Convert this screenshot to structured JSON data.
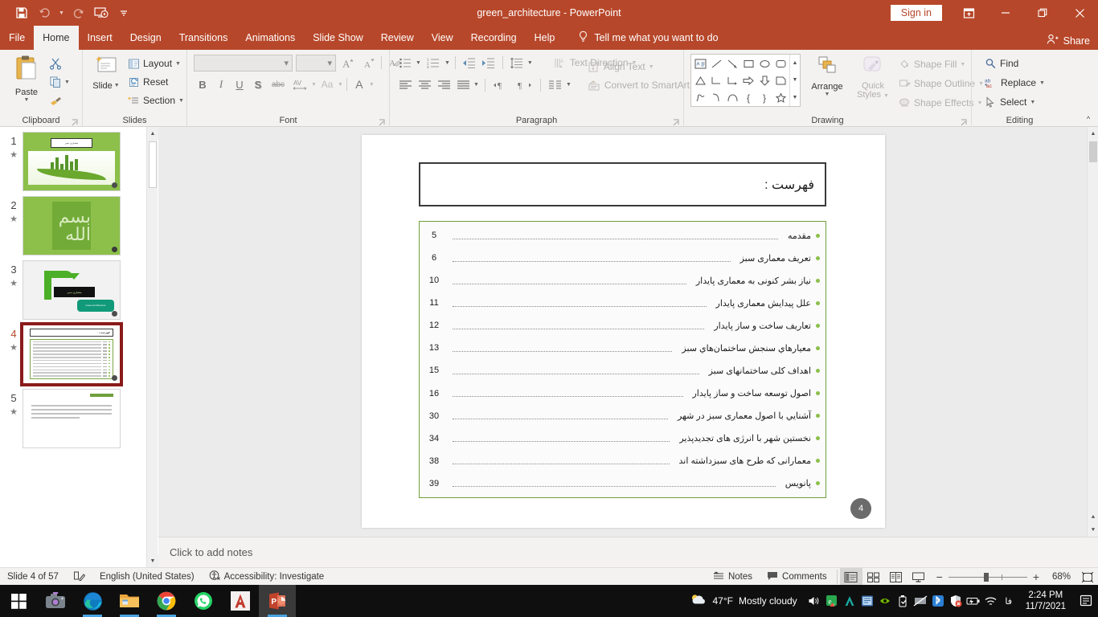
{
  "titlebar": {
    "document_title": "green_architecture  -  PowerPoint",
    "quick_access": [
      {
        "name": "save-icon",
        "label": "Save"
      },
      {
        "name": "undo-icon",
        "label": "Undo"
      },
      {
        "name": "redo-icon",
        "label": "Redo"
      },
      {
        "name": "start-presentation-icon",
        "label": "Start From Beginning"
      },
      {
        "name": "customize-qat-icon",
        "label": "Customize Quick Access Toolbar"
      }
    ],
    "sign_in": "Sign in",
    "ribbon_display_options": "Ribbon Display Options",
    "minimize": "Minimize",
    "restore": "Restore Down",
    "close": "Close"
  },
  "tabs": [
    {
      "label": "File",
      "active": false
    },
    {
      "label": "Home",
      "active": true
    },
    {
      "label": "Insert",
      "active": false
    },
    {
      "label": "Design",
      "active": false
    },
    {
      "label": "Transitions",
      "active": false
    },
    {
      "label": "Animations",
      "active": false
    },
    {
      "label": "Slide Show",
      "active": false
    },
    {
      "label": "Review",
      "active": false
    },
    {
      "label": "View",
      "active": false
    },
    {
      "label": "Recording",
      "active": false
    },
    {
      "label": "Help",
      "active": false
    }
  ],
  "tell_me": "Tell me what you want to do",
  "share": "Share",
  "ribbon": {
    "clipboard": {
      "label": "Clipboard",
      "paste": "Paste",
      "cut": "Cut",
      "copy": "Copy",
      "format_painter": "Format Painter"
    },
    "slides": {
      "label": "Slides",
      "new_slide": "New\nSlide",
      "new_slide_line1": "New",
      "new_slide_line2": "Slide",
      "layout": "Layout",
      "reset": "Reset",
      "section": "Section"
    },
    "font": {
      "label": "Font",
      "font_name": "",
      "font_size": "",
      "increase_size": "Increase Font Size",
      "decrease_size": "Decrease Font Size",
      "clear_formatting": "Clear All Formatting",
      "bold": "B",
      "italic": "I",
      "underline": "U",
      "shadow": "S",
      "strikethrough": "abc",
      "character_spacing": "AV",
      "change_case": "Aa",
      "font_color": "A"
    },
    "paragraph": {
      "label": "Paragraph",
      "bullets": "Bullets",
      "numbering": "Numbering",
      "decrease_indent": "Decrease List Level",
      "increase_indent": "Increase List Level",
      "line_spacing": "Line Spacing",
      "align_left": "Align Left",
      "align_center": "Center",
      "align_right": "Align Right",
      "justify": "Justify",
      "ltr": "Left-to-Right Text Direction",
      "rtl": "Right-to-Left Text Direction",
      "columns": "Columns",
      "text_direction": "Text Direction",
      "align_text": "Align Text",
      "convert_to_smartart": "Convert to SmartArt"
    },
    "drawing": {
      "label": "Drawing",
      "arrange": "Arrange",
      "quick_styles_line1": "Quick",
      "quick_styles_line2": "Styles",
      "shape_fill": "Shape Fill",
      "shape_outline": "Shape Outline",
      "shape_effects": "Shape Effects"
    },
    "editing": {
      "label": "Editing",
      "find": "Find",
      "replace": "Replace",
      "select": "Select"
    },
    "collapse": "Collapse the Ribbon"
  },
  "thumbnails": [
    {
      "number": "1",
      "selected": false,
      "title_text": "معماری سبز"
    },
    {
      "number": "2",
      "selected": false,
      "title_text": "بسم الله"
    },
    {
      "number": "3",
      "selected": false,
      "title_text": "معماری سبز",
      "badge_text": "Green Architecture"
    },
    {
      "number": "4",
      "selected": true,
      "title_text": "فهرست :"
    },
    {
      "number": "5",
      "selected": false,
      "title_text": "مقدمه"
    }
  ],
  "slide": {
    "title": "فهرست :",
    "badge": "4",
    "toc": [
      {
        "label": "مقدمه",
        "page": "5"
      },
      {
        "label": "تعریف معماری سبز",
        "page": "6"
      },
      {
        "label": "نیاز بشر کنونی به معماری پایدار",
        "page": "10"
      },
      {
        "label": "علل پیدایش معماری پایدار",
        "page": "11"
      },
      {
        "label": "تعاریف ساخت و ساز پایدار",
        "page": "12"
      },
      {
        "label": "معیارهاي سنجش ساختمان‌هاي سبز",
        "page": "13"
      },
      {
        "label": "اهداف کلی ساختمانهای سبز",
        "page": "15"
      },
      {
        "label": "اصول توسعه ساخت و ساز پایدار",
        "page": "16"
      },
      {
        "label": "آشنایي با اصول معماری سبز در شهر",
        "page": "30"
      },
      {
        "label": "نخستین شهر با انرژی های تجدیدپذیر",
        "page": "34"
      },
      {
        "label": "معمارانی که طرح های سبزداشته اند",
        "page": "38"
      },
      {
        "label": "پانویس",
        "page": "39"
      }
    ]
  },
  "notes": {
    "placeholder": "Click to add notes"
  },
  "statusbar": {
    "slide_indicator": "Slide 4 of 57",
    "spellcheck": "Spelling and Grammar Check",
    "language": "English (United States)",
    "accessibility": "Accessibility: Investigate",
    "notes": "Notes",
    "comments": "Comments",
    "view_normal": "Normal",
    "view_slide_sorter": "Slide Sorter",
    "view_reading": "Reading View",
    "view_slideshow": "Slide Show",
    "zoom_out": "Zoom Out",
    "zoom_in": "Zoom In",
    "zoom_level": "68%",
    "fit_to_window": "Fit slide to current window"
  },
  "taskbar": {
    "apps": [
      {
        "name": "start-button",
        "label": "Start"
      },
      {
        "name": "camera-icon",
        "label": "Camera"
      },
      {
        "name": "edge-icon",
        "label": "Microsoft Edge"
      },
      {
        "name": "file-explorer-icon",
        "label": "File Explorer"
      },
      {
        "name": "chrome-icon",
        "label": "Google Chrome"
      },
      {
        "name": "whatsapp-icon",
        "label": "WhatsApp"
      },
      {
        "name": "autocad-icon",
        "label": "AutoCAD"
      },
      {
        "name": "powerpoint-icon",
        "label": "PowerPoint"
      }
    ],
    "weather_temp": "47°F",
    "weather_desc": "Mostly cloudy",
    "time": "2:24 PM",
    "date": "11/7/2021",
    "tray_icons": [
      {
        "name": "volume-icon",
        "label": "Volume"
      },
      {
        "name": "antivirus-icon",
        "label": "Antivirus"
      },
      {
        "name": "autodesk-icon",
        "label": "Autodesk"
      },
      {
        "name": "network-app-icon",
        "label": "Network App"
      },
      {
        "name": "nvidia-icon",
        "label": "NVIDIA Settings"
      },
      {
        "name": "usb-eject-icon",
        "label": "Safely Remove Hardware"
      },
      {
        "name": "display-off-icon",
        "label": "Display"
      },
      {
        "name": "bluetooth-icon",
        "label": "Bluetooth"
      },
      {
        "name": "security-icon",
        "label": "Windows Security"
      },
      {
        "name": "battery-icon",
        "label": "Battery"
      },
      {
        "name": "wifi-icon",
        "label": "Network"
      },
      {
        "name": "keyboard-layout-icon",
        "label": "فا"
      }
    ],
    "notification_center": "Notifications"
  },
  "colors": {
    "brand": "#b7472a",
    "ribbon_bg": "#f3f2f1",
    "accent_green": "#8cc04a",
    "slide_border_green": "#6fa03a",
    "selection_red": "#8b1a1a"
  }
}
